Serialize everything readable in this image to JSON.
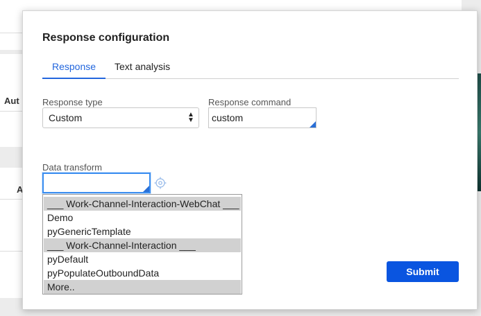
{
  "background": {
    "col_header_1": "Aut",
    "col_header_2": "A"
  },
  "modal": {
    "title": "Response configuration",
    "tabs": [
      {
        "label": "Response",
        "active": true
      },
      {
        "label": "Text analysis",
        "active": false
      }
    ],
    "response_type": {
      "label": "Response type",
      "value": "Custom"
    },
    "response_command": {
      "label": "Response command",
      "value": "custom"
    },
    "data_transform": {
      "label": "Data transform",
      "value": ""
    },
    "dropdown_items": [
      {
        "label": "___ Work-Channel-Interaction-WebChat ___",
        "group_header": true
      },
      {
        "label": "Demo",
        "group_header": false
      },
      {
        "label": "pyGenericTemplate",
        "group_header": false
      },
      {
        "label": "___ Work-Channel-Interaction ___",
        "group_header": true
      },
      {
        "label": "pyDefault",
        "group_header": false
      },
      {
        "label": "pyPopulateOutboundData",
        "group_header": false
      },
      {
        "label": "More..",
        "group_header": true
      }
    ],
    "submit_label": "Submit"
  },
  "colors": {
    "accent": "#2266dd",
    "submit": "#0a55e0",
    "focus": "#3b8ef0"
  }
}
